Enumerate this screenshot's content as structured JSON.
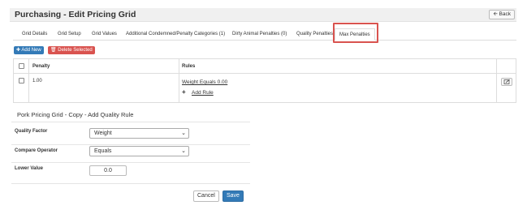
{
  "header": {
    "title": "Purchasing - Edit Pricing Grid",
    "back_label": "Back",
    "back_icon": "arrow-left-icon"
  },
  "tabs": [
    {
      "label": "Grid Details",
      "active": false
    },
    {
      "label": "Grid Setup",
      "active": false
    },
    {
      "label": "Grid Values",
      "active": false
    },
    {
      "label": "Additional Condemned/Penalty Categories (1)",
      "active": false
    },
    {
      "label": "Dirty Animal Penalties (0)",
      "active": false
    },
    {
      "label": "Quality Penalties",
      "active": false
    },
    {
      "label": "Max Penalties",
      "active": true
    }
  ],
  "toolbar": {
    "add_label": "Add New",
    "delete_label": "Delete Selected",
    "colors": {
      "add": "#337ab7",
      "delete": "#d9534f"
    }
  },
  "grid": {
    "columns": [
      "Penalty",
      "Rules"
    ],
    "rows": [
      {
        "penalty": "1.00",
        "rule": "Weight Equals 0.00",
        "add_rule_label": "Add Rule"
      }
    ]
  },
  "modal": {
    "title": "Pork Pricing Grid - Copy - Add Quality Rule",
    "fields": {
      "quality_factor": {
        "label": "Quality Factor",
        "value": "Weight"
      },
      "compare_operator": {
        "label": "Compare Operator",
        "value": "Equals"
      },
      "lower_value": {
        "label": "Lower Value",
        "value": "0.0"
      }
    },
    "cancel_label": "Cancel",
    "save_label": "Save"
  },
  "highlight_color": "#d9534f"
}
